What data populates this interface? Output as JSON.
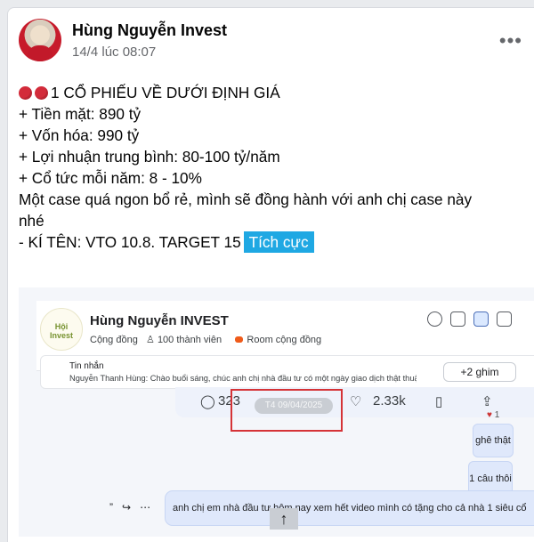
{
  "post": {
    "author": "Hùng Nguyễn Invest",
    "timestamp": "14/4 lúc 08:07",
    "more_label": "•••"
  },
  "content": {
    "headline": "1 CỔ PHIẾU VỀ DƯỚI ĐỊNH GIÁ",
    "line1": "+ Tiền mặt: 890 tỷ",
    "line2": "+ Vốn hóa: 990 tỷ",
    "line3": "+ Lợi nhuận trung bình: 80-100 tỷ/năm",
    "line4": "+ Cổ tức mỗi năm: 8 - 10%",
    "line5": "Một case quá ngon bổ rẻ, mình sẽ đồng hành với anh chị case này",
    "line6": "nhé",
    "line7": "- KÍ TÊN: VTO 10.8. TARGET 15",
    "tag": "Tích cực"
  },
  "screenshot": {
    "title": "Hùng Nguyễn INVEST",
    "subtitle_group": "Cộng đồng",
    "members": "100 thành viên",
    "room": "Room cộng đồng",
    "pin_label": "Tin nhắn",
    "pin_text": "Nguyễn Thanh Hùng: Chào buổi sáng, chúc anh chị nhà đầu tư có một ngày giao dịch thật thuận...",
    "pin_badge": "+2 ghim",
    "comments": "323",
    "likes": "2.33k",
    "date_chip": "T4 09/04/2025",
    "reaction": "1",
    "bubble1": "ghê thật",
    "bubble2": "1 câu thôi",
    "bubble3": "anh chị em nhà đầu tư hôm nay xem hết video mình có tặng cho cả nhà 1 siêu cổ",
    "up_arrow": "↑"
  }
}
